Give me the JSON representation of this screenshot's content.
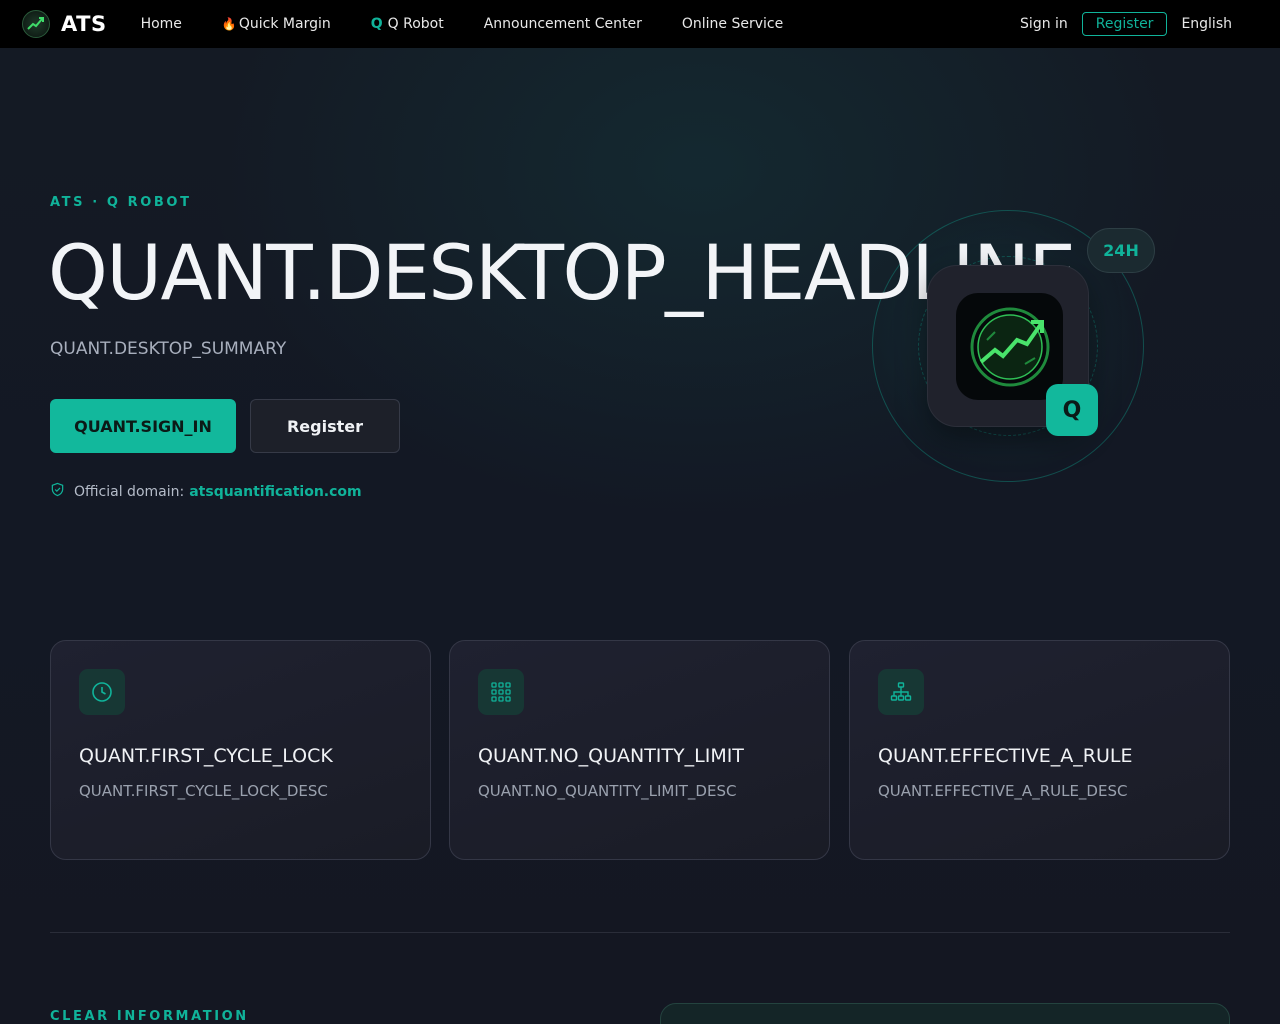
{
  "nav": {
    "brand": "ATS",
    "links": [
      {
        "label": "Home"
      },
      {
        "label": "Quick Margin",
        "icon": "fire-icon"
      },
      {
        "label": "Q Robot",
        "prefix": "Q"
      },
      {
        "label": "Announcement Center"
      },
      {
        "label": "Online Service"
      }
    ],
    "signin": "Sign in",
    "register": "Register",
    "language": "English"
  },
  "hero": {
    "eyebrow": "ATS · Q ROBOT",
    "headline": "QUANT.DESKTOP_HEADLINE",
    "summary": "QUANT.DESKTOP_SUMMARY",
    "primary_button": "QUANT.SIGN_IN",
    "secondary_button": "Register",
    "domain_label": "Official domain:",
    "domain_value": "atsquantification.com",
    "badge_24h": "24H",
    "badge_q": "Q"
  },
  "cards": [
    {
      "icon": "clock-icon",
      "title": "QUANT.FIRST_CYCLE_LOCK",
      "desc": "QUANT.FIRST_CYCLE_LOCK_DESC"
    },
    {
      "icon": "grid-icon",
      "title": "QUANT.NO_QUANTITY_LIMIT",
      "desc": "QUANT.NO_QUANTITY_LIMIT_DESC"
    },
    {
      "icon": "hierarchy-icon",
      "title": "QUANT.EFFECTIVE_A_RULE",
      "desc": "QUANT.EFFECTIVE_A_RULE_DESC"
    }
  ],
  "section": {
    "eyebrow": "CLEAR INFORMATION"
  },
  "colors": {
    "accent": "#10b39a",
    "nav_bg": "#000000",
    "page_bg": "#141722",
    "card_bg": "#1f2130"
  }
}
